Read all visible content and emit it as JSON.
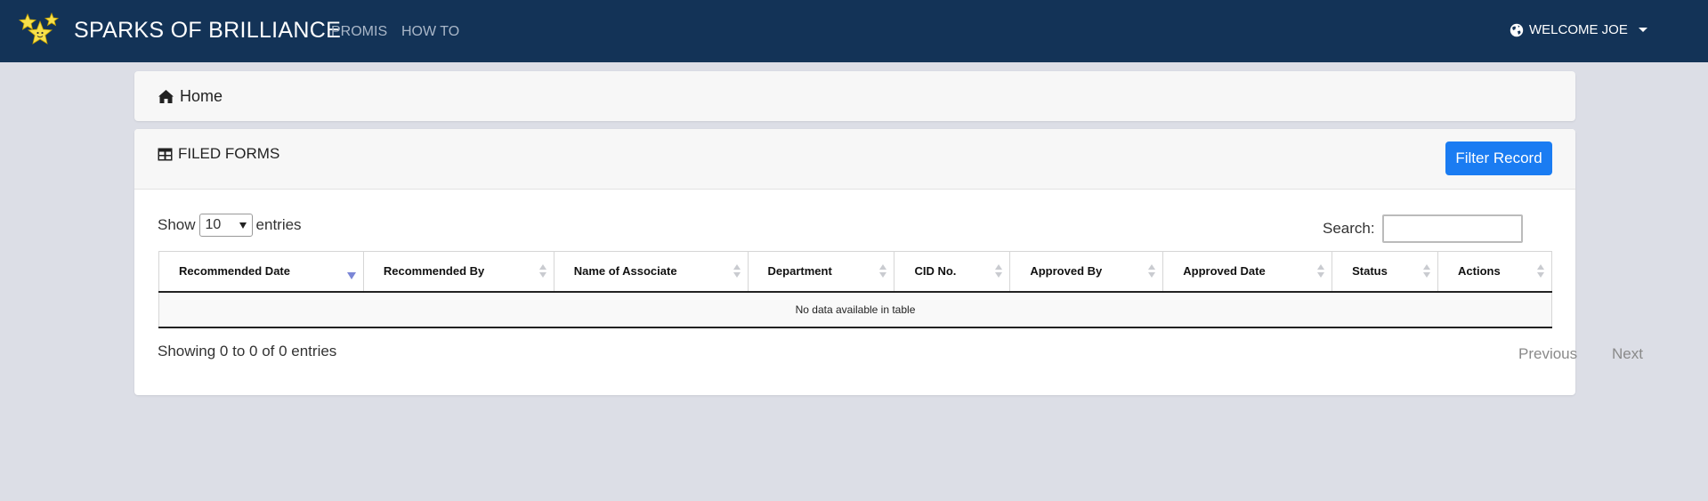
{
  "navbar": {
    "brand": "SPARKS OF BRILLIANCE",
    "links": [
      "PROMIS",
      "HOW TO"
    ],
    "welcome": "WELCOME JOE"
  },
  "breadcrumb": {
    "home": "Home"
  },
  "card": {
    "title": "FILED FORMS",
    "filter_button": "Filter Record"
  },
  "table_controls": {
    "show_label": "Show",
    "entries_value": "10",
    "entries_label": "entries",
    "search_label": "Search:",
    "search_value": ""
  },
  "table": {
    "columns": [
      "Recommended Date",
      "Recommended By",
      "Name of Associate",
      "Department",
      "CID No.",
      "Approved By",
      "Approved Date",
      "Status",
      "Actions"
    ],
    "empty_message": "No data available in table"
  },
  "footer": {
    "info": "Showing 0 to 0 of 0 entries",
    "previous": "Previous",
    "next": "Next"
  },
  "colors": {
    "navbar": "#133357",
    "primary_button": "#1a7cf2",
    "page_bg": "#dcdee6"
  }
}
